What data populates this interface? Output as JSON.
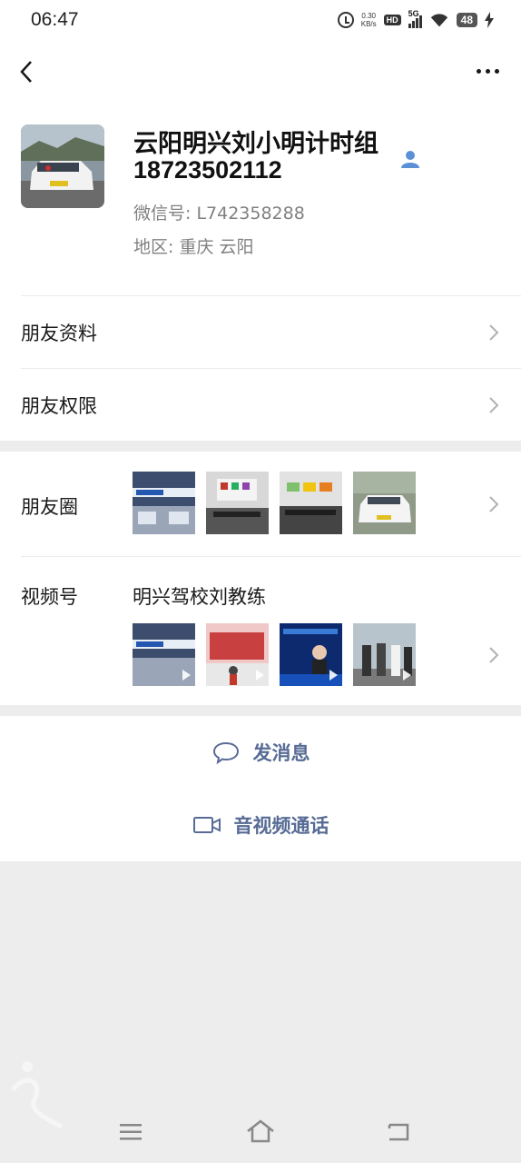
{
  "status": {
    "time": "06:47",
    "net_speed_value": "0.30",
    "net_speed_unit": "KB/s",
    "hd": "HD",
    "network": "5G",
    "battery": "48"
  },
  "profile": {
    "name_line1": "云阳明兴刘小明计时组",
    "name_line2": "18723502112",
    "wechat_id": "微信号:  L742358288",
    "region": "地区:  重庆  云阳"
  },
  "rows": {
    "friend_info": "朋友资料",
    "friend_permissions": "朋友权限",
    "moments": "朋友圈",
    "channels": "视频号",
    "channels_name": "明兴驾校刘教练"
  },
  "actions": {
    "message": "发消息",
    "video_call": "音视频通话"
  },
  "colors": {
    "link_blue": "#576b95",
    "background_gray": "#ededed"
  },
  "icons": [
    "alarm-icon",
    "hd-icon",
    "signal-icon",
    "wifi-icon",
    "battery-icon",
    "charging-icon",
    "back-icon",
    "more-icon",
    "person-icon",
    "chevron-right-icon",
    "chat-bubble-icon",
    "video-camera-icon",
    "menu-icon",
    "home-icon",
    "return-icon"
  ]
}
